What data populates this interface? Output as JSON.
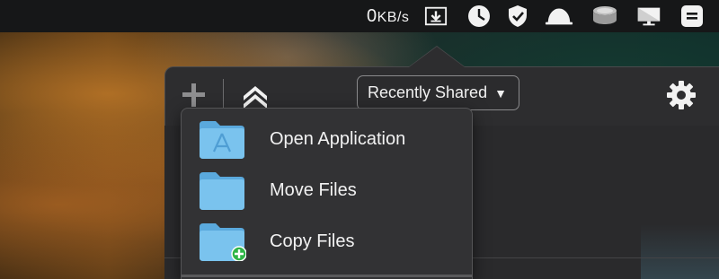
{
  "menubar": {
    "network_speed_value": "0",
    "network_speed_unit": "KB/s",
    "tray_icons": [
      "download-icon",
      "clock-icon",
      "check-shield-icon",
      "cloud-dome-icon",
      "disk-icon",
      "display-icon",
      "menu-list-icon"
    ]
  },
  "popover": {
    "filter_label": "Recently Shared",
    "toolbar_icons": [
      "plus-icon",
      "double-chevron-up-icon",
      "gear-icon"
    ]
  },
  "menu": {
    "items": [
      {
        "label": "Open Application",
        "icon": "app-folder-icon"
      },
      {
        "label": "Move Files",
        "icon": "folder-icon"
      },
      {
        "label": "Copy Files",
        "icon": "folder-add-icon"
      }
    ]
  },
  "colors": {
    "folder_blue": "#7ac3ee",
    "folder_tab": "#5aa9dd",
    "add_green": "#2fb547"
  }
}
